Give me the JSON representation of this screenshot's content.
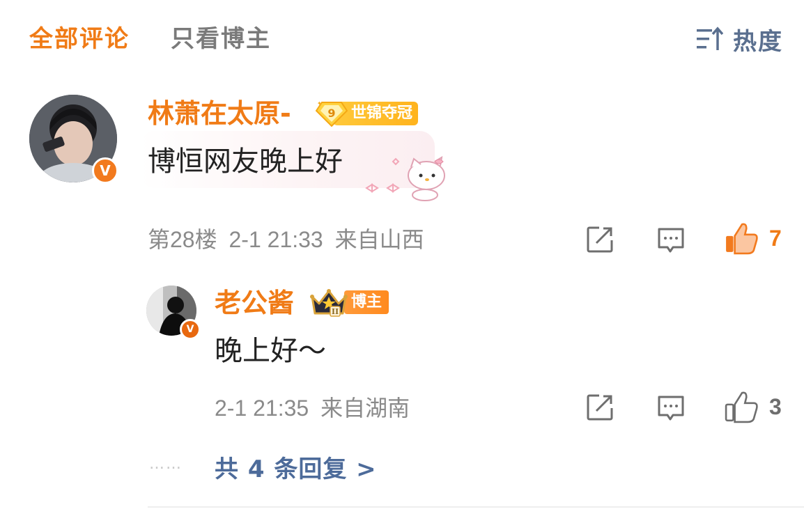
{
  "tabs": {
    "all_comments": "全部评论",
    "blogger_only": "只看博主",
    "sort_label": "热度"
  },
  "comment": {
    "username": "林萧在太原-",
    "badge_level": "9",
    "badge_text": "世锦夺冠",
    "text": "博恒网友晚上好",
    "floor": "第28楼",
    "time": "2-1 21:33",
    "location": "来自山西",
    "likes": "7",
    "liked": true
  },
  "reply": {
    "username": "老公酱",
    "crown_level": "II",
    "badge_text": "博主",
    "text": "晚上好～",
    "time": "2-1 21:35",
    "location": "来自湖南",
    "likes": "3",
    "liked": false
  },
  "more": {
    "dots": "……",
    "label": "共 4 条回复 >"
  },
  "verified_mark": "V",
  "colors": {
    "accent": "#f07b16",
    "link": "#4d6b9a",
    "meta": "#8a8a8a"
  }
}
